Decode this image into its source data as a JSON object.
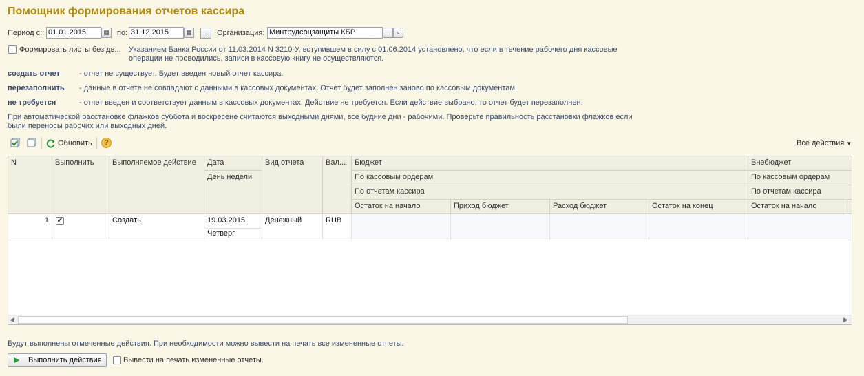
{
  "window": {
    "title": "Помощник формирования отчетов кассира"
  },
  "filters": {
    "period_from_label": "Период с:",
    "period_from_value": "01.01.2015",
    "period_to_label": "по:",
    "period_to_value": "31.12.2015",
    "org_label": "Организация:",
    "org_value": "Минтрудсоцзащиты КБР",
    "org_more": "...",
    "ellipsis_btn": "..."
  },
  "option": {
    "weekend_label": "Формировать листы без дв...",
    "note_line1": "Указанием Банка России от 11.03.2014 N 3210-У, вступившем в силу с 01.06.2014 установлено, что если в течение рабочего дня кассовые",
    "note_line2": "операции не проводились, записи в кассовую книгу не осуществляются."
  },
  "legend": [
    {
      "key": "создать отчет",
      "text": "- отчет не существует.  Будет введен новый отчет кассира."
    },
    {
      "key": "перезаполнить",
      "text": "- данные в отчете не совпадают с данными в кассовых документах. Отчет будет заполнен заново по кассовым документам."
    },
    {
      "key": "не требуется",
      "text": "- отчет введен и соответствует данным в кассовых документах. Действие не требуется. Если действие выбрано, то отчет будет перезаполнен."
    }
  ],
  "weekend_note_line1": "При автоматической расстановке флажков суббота и воскресене считаются выходными днями, все будние дни - рабочими. Проверьте правильность расстановки флажков если",
  "weekend_note_line2": "были переносы рабочих или выходных дней.",
  "toolbar": {
    "refresh_label": "Обновить",
    "help_label": "?",
    "all_actions_label": "Все действия"
  },
  "table": {
    "headers": {
      "n": "N",
      "execute": "Выполнить",
      "action": "Выполняемое действие",
      "date": "Дата",
      "weekday": "День недели",
      "report_type": "Вид отчета",
      "currency": "Вал...",
      "budget": "Бюджет",
      "budget_sub1": "По кассовым ордерам",
      "budget_sub2": "По отчетам кассира",
      "start_balance": "Остаток на начало",
      "income_budget": "Приход бюджет",
      "expense_budget": "Расход бюджет",
      "end_balance": "Остаток на конец",
      "offbudget": "Внебюджет",
      "offbudget_sub1": "По кассовым ордерам",
      "offbudget_sub2": "По отчетам кассира",
      "offbudget_start_balance": "Остаток на начало"
    },
    "rows": [
      {
        "n": "1",
        "checked": "✔",
        "action": "Создать",
        "date": "19.03.2015",
        "weekday": "Четверг",
        "report_type": "Денежный",
        "currency": "RUB"
      }
    ]
  },
  "footer": {
    "note": "Будут выполнены отмеченные действия. При необходимости можно вывести на печать все измененные отчеты.",
    "execute_button": "Выполнить действия",
    "print_changed_label": "Вывести на печать измененные отчеты."
  },
  "colors": {
    "title": "#b28a0d",
    "info_text": "#3a4a6a",
    "background": "#fbf7e6"
  }
}
